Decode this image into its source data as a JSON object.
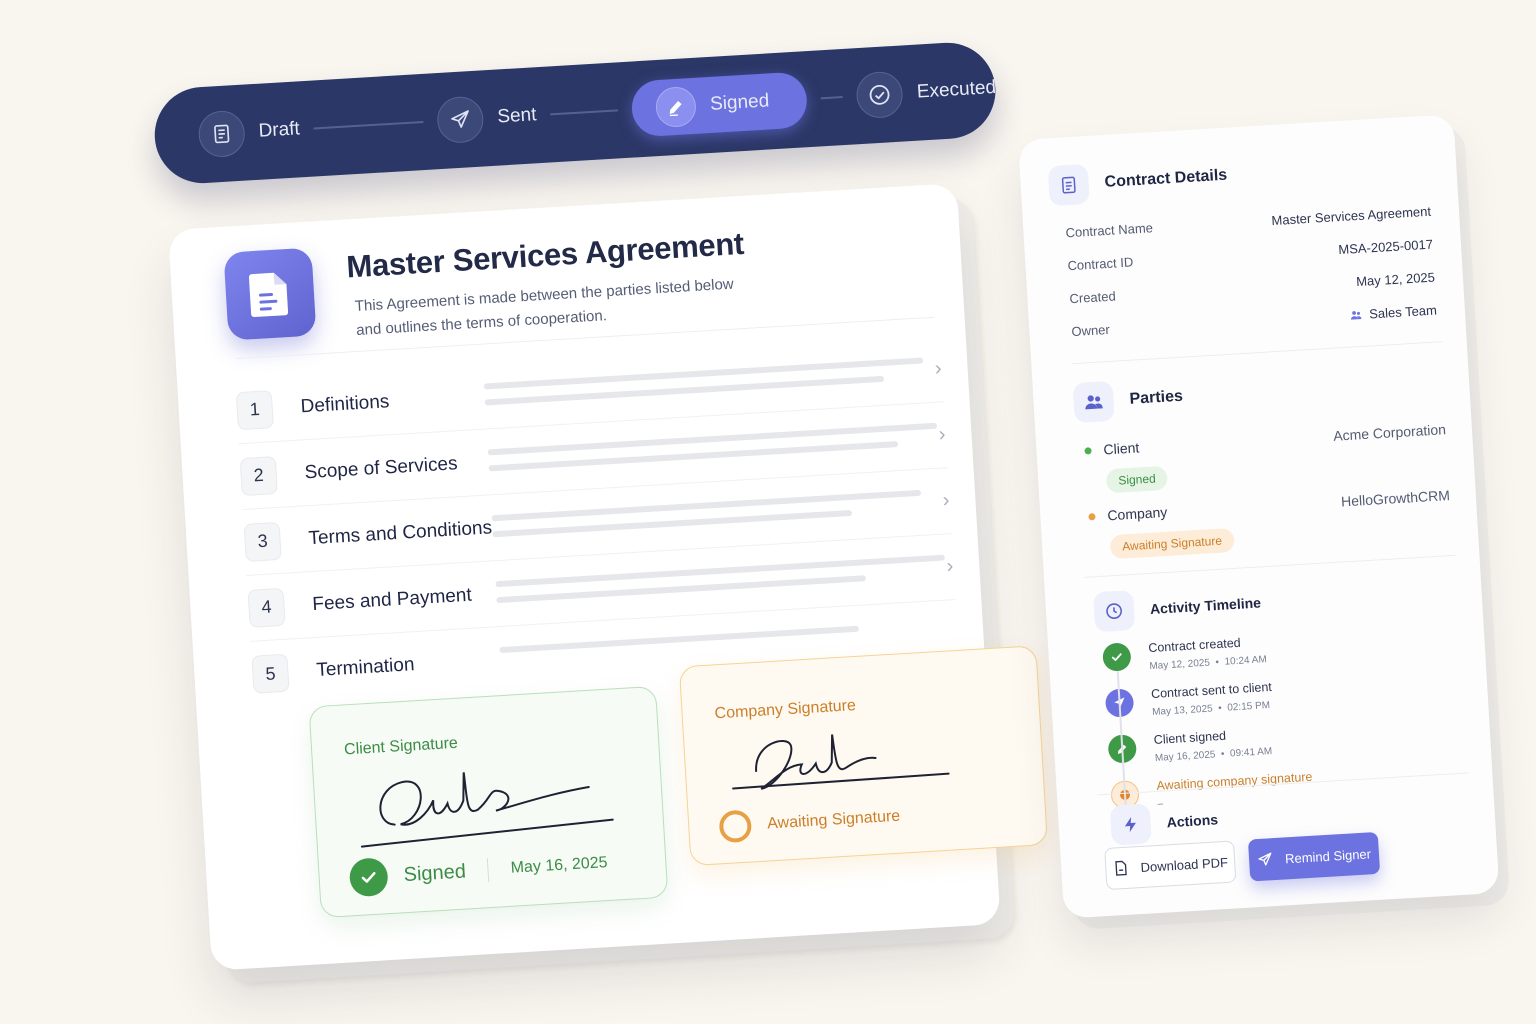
{
  "status_steps": [
    {
      "label": "Draft",
      "icon": "document-icon",
      "active": false
    },
    {
      "label": "Sent",
      "icon": "send-icon",
      "active": false
    },
    {
      "label": "Signed",
      "icon": "pen-icon",
      "active": true
    },
    {
      "label": "Executed",
      "icon": "check-circle-icon",
      "active": false
    }
  ],
  "document": {
    "title": "Master Services Agreement",
    "subtitle": "This Agreement is made between the parties listed below and outlines the terms of cooperation.",
    "sections": [
      {
        "number": "1",
        "label": "Definitions"
      },
      {
        "number": "2",
        "label": "Scope of Services"
      },
      {
        "number": "3",
        "label": "Terms and Conditions"
      },
      {
        "number": "4",
        "label": "Fees and Payment"
      },
      {
        "number": "5",
        "label": "Termination"
      }
    ],
    "client_signature": {
      "title": "Client Signature",
      "status": "Signed",
      "date": "May 16, 2025"
    },
    "company_signature": {
      "title": "Company Signature",
      "status": "Awaiting Signature"
    }
  },
  "details": {
    "title": "Contract Details",
    "fields": [
      {
        "key": "Contract Name",
        "value": "Master Services Agreement"
      },
      {
        "key": "Contract ID",
        "value": "MSA-2025-0017"
      },
      {
        "key": "Created",
        "value": "May 12, 2025"
      },
      {
        "key": "Owner",
        "value": "Sales Team"
      }
    ]
  },
  "parties": {
    "title": "Parties",
    "items": [
      {
        "role": "Client",
        "org": "Acme Corporation",
        "status": "Signed",
        "color": "#4caf50"
      },
      {
        "role": "Company",
        "org": "HelloGrowthCRM",
        "status": "Awaiting Signature",
        "color": "#e6a046"
      }
    ]
  },
  "timeline": {
    "title": "Activity Timeline",
    "items": [
      {
        "text": "Contract created",
        "date": "May 12, 2025",
        "time": "10:24 AM",
        "icon": "check-icon",
        "color": "#3f9a48"
      },
      {
        "text": "Contract sent to client",
        "date": "May 13, 2025",
        "time": "02:15 PM",
        "icon": "send-icon",
        "color": "#6c72e0"
      },
      {
        "text": "Client signed",
        "date": "May 16, 2025",
        "time": "09:41 AM",
        "icon": "pen-icon",
        "color": "#3f9a48"
      },
      {
        "text": "Awaiting company signature",
        "date": "",
        "time": "",
        "icon": "pending-icon",
        "color": "#e6a046"
      }
    ]
  },
  "actions": {
    "title": "Actions",
    "download_label": "Download PDF",
    "remind_label": "Remind Signer"
  },
  "colors": {
    "navy": "#2b3766",
    "accent": "#6c72e0",
    "success": "#3f9a48",
    "warning": "#e6a046"
  }
}
